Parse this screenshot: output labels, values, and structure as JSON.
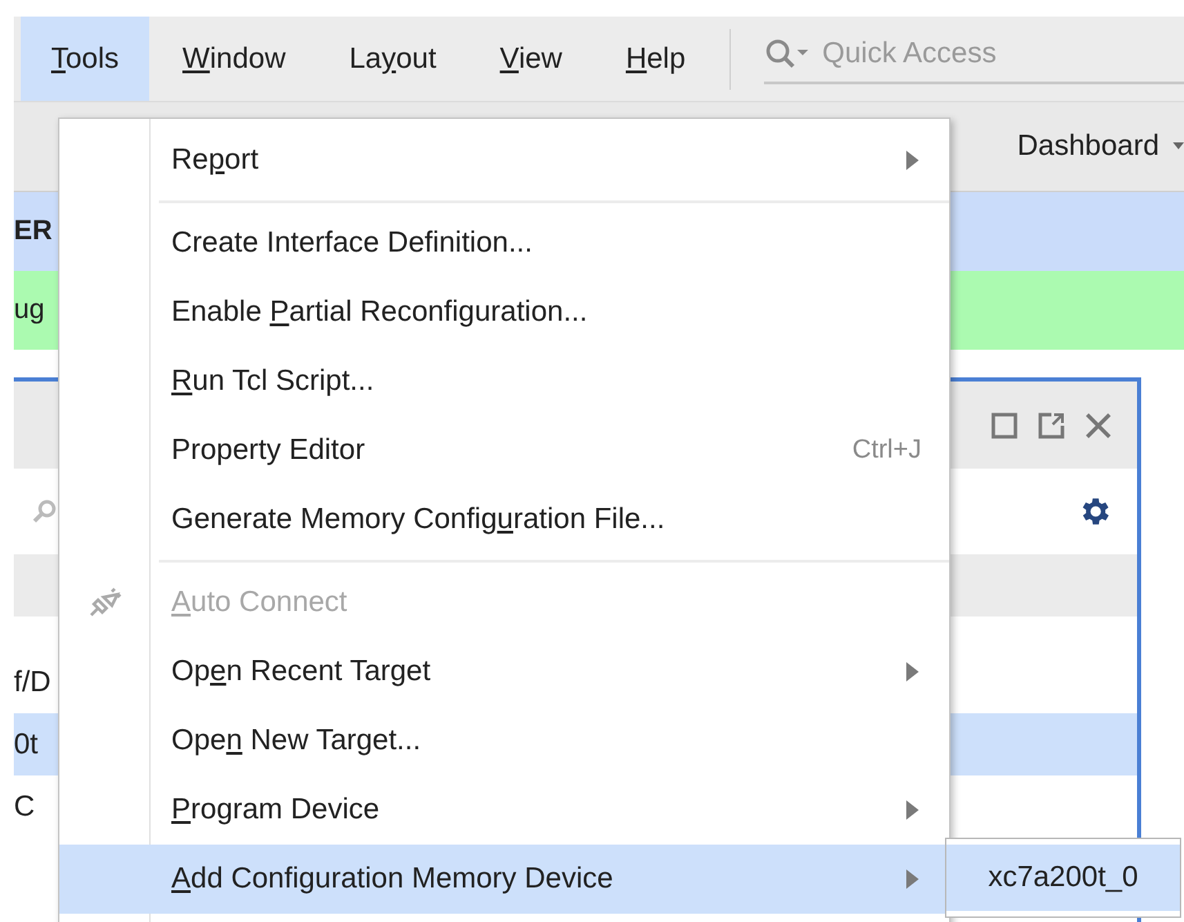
{
  "menubar": {
    "items": [
      {
        "label": [
          {
            "text": "T",
            "underline": true
          },
          {
            "text": "ools",
            "underline": false
          }
        ],
        "selected": true
      },
      {
        "label": [
          {
            "text": "W",
            "underline": true
          },
          {
            "text": "indow",
            "underline": false
          }
        ],
        "selected": false
      },
      {
        "label": [
          {
            "text": "La",
            "underline": false
          },
          {
            "text": "y",
            "underline": true
          },
          {
            "text": "out",
            "underline": false
          }
        ],
        "selected": false
      },
      {
        "label": [
          {
            "text": "V",
            "underline": true
          },
          {
            "text": "iew",
            "underline": false
          }
        ],
        "selected": false
      },
      {
        "label": [
          {
            "text": "H",
            "underline": true
          },
          {
            "text": "elp",
            "underline": false
          }
        ],
        "selected": false
      }
    ],
    "quick_access": {
      "placeholder": "Quick Access"
    }
  },
  "toolbar": {
    "layout_menu": "Dashboard"
  },
  "banners": [
    {
      "kind": "info",
      "text": "ER"
    },
    {
      "kind": "success",
      "text": "ug"
    }
  ],
  "panel": {
    "rows": [
      {
        "text": "f/D",
        "selected": false
      },
      {
        "text": "0t",
        "selected": true
      },
      {
        "text": "C",
        "selected": false
      }
    ]
  },
  "menu": {
    "items": [
      {
        "kind": "item",
        "label": [
          {
            "text": "Re",
            "underline": false
          },
          {
            "text": "p",
            "underline": true
          },
          {
            "text": "ort",
            "underline": false
          }
        ],
        "has_submenu": true,
        "disabled": false,
        "has_icon": false,
        "selected": false
      },
      {
        "kind": "separator"
      },
      {
        "kind": "item",
        "label": [
          {
            "text": "Create Interface Definition...",
            "underline": false
          }
        ],
        "has_submenu": false,
        "disabled": false,
        "has_icon": false,
        "selected": false
      },
      {
        "kind": "item",
        "label": [
          {
            "text": "Enable ",
            "underline": false
          },
          {
            "text": "P",
            "underline": true
          },
          {
            "text": "artial Reconfiguration...",
            "underline": false
          }
        ],
        "has_submenu": false,
        "disabled": false,
        "has_icon": false,
        "selected": false
      },
      {
        "kind": "item",
        "label": [
          {
            "text": "R",
            "underline": true
          },
          {
            "text": "un Tcl Script...",
            "underline": false
          }
        ],
        "has_submenu": false,
        "disabled": false,
        "has_icon": false,
        "selected": false
      },
      {
        "kind": "item",
        "label": [
          {
            "text": "Property Editor",
            "underline": false
          }
        ],
        "shortcut": "Ctrl+J",
        "has_submenu": false,
        "disabled": false,
        "has_icon": false,
        "selected": false
      },
      {
        "kind": "item",
        "label": [
          {
            "text": "Generate Memory Config",
            "underline": false
          },
          {
            "text": "u",
            "underline": true
          },
          {
            "text": "ration File...",
            "underline": false
          }
        ],
        "has_submenu": false,
        "disabled": false,
        "has_icon": false,
        "selected": false
      },
      {
        "kind": "separator"
      },
      {
        "kind": "item",
        "label": [
          {
            "text": "A",
            "underline": true
          },
          {
            "text": "uto Connect",
            "underline": false
          }
        ],
        "has_submenu": false,
        "disabled": true,
        "has_icon": true,
        "selected": false
      },
      {
        "kind": "item",
        "label": [
          {
            "text": "Op",
            "underline": false
          },
          {
            "text": "e",
            "underline": true
          },
          {
            "text": "n Recent Target",
            "underline": false
          }
        ],
        "has_submenu": true,
        "disabled": false,
        "has_icon": false,
        "selected": false
      },
      {
        "kind": "item",
        "label": [
          {
            "text": "Ope",
            "underline": false
          },
          {
            "text": "n",
            "underline": true
          },
          {
            "text": " New Target...",
            "underline": false
          }
        ],
        "has_submenu": false,
        "disabled": false,
        "has_icon": false,
        "selected": false
      },
      {
        "kind": "item",
        "label": [
          {
            "text": "P",
            "underline": true
          },
          {
            "text": "rogram Device",
            "underline": false
          }
        ],
        "has_submenu": true,
        "disabled": false,
        "has_icon": false,
        "selected": false
      },
      {
        "kind": "item",
        "label": [
          {
            "text": "A",
            "underline": true
          },
          {
            "text": "dd Configuration Memory Device",
            "underline": false
          }
        ],
        "has_submenu": true,
        "disabled": false,
        "has_icon": false,
        "selected": true
      }
    ]
  },
  "submenu": {
    "items": [
      {
        "label": "xc7a200t_0",
        "selected": true
      }
    ]
  }
}
